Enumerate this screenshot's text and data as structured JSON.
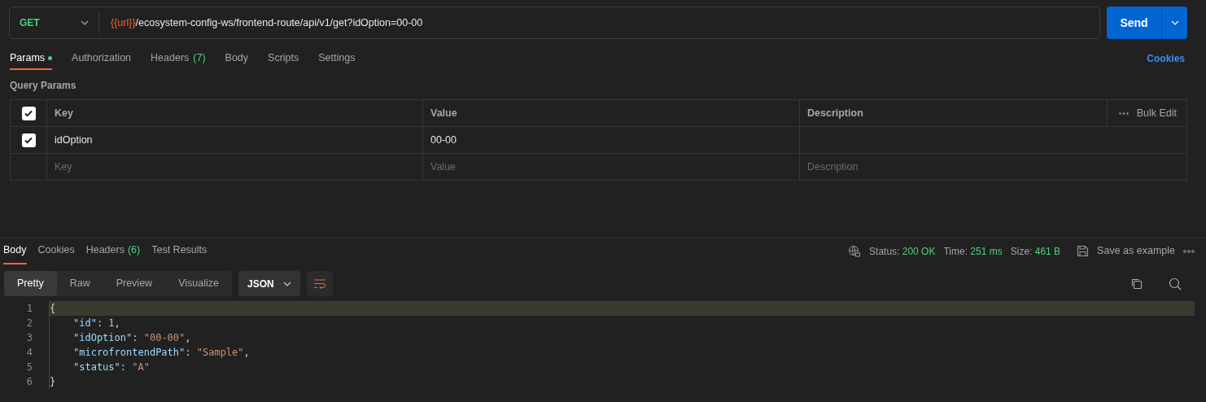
{
  "request": {
    "method": "GET",
    "url_variable": "{{url}}",
    "url_path": "/ecosystem-config-ws/frontend-route/api/v1/get?idOption=00-00",
    "send": "Send"
  },
  "request_tabs": [
    {
      "label": "Params",
      "selected": true,
      "dot": true
    },
    {
      "label": "Authorization",
      "selected": false,
      "dot": false
    },
    {
      "label": "Headers",
      "count": "(7)",
      "selected": false,
      "dot": false
    },
    {
      "label": "Body",
      "selected": false,
      "dot": false
    },
    {
      "label": "Scripts",
      "selected": false,
      "dot": false
    },
    {
      "label": "Settings",
      "selected": false,
      "dot": false
    }
  ],
  "cookies_link": "Cookies",
  "query_params": {
    "title": "Query Params",
    "columns": [
      "Key",
      "Value",
      "Description"
    ],
    "bulk_edit": "Bulk Edit",
    "all_checked": true,
    "rows": [
      {
        "key": "idOption",
        "value": "00-00",
        "checked": true
      }
    ],
    "new_row": {
      "key_placeholder": "Key",
      "value_placeholder": "Value",
      "description_placeholder": "Description"
    }
  },
  "response": {
    "tabs": [
      {
        "label": "Body",
        "selected": true
      },
      {
        "label": "Cookies",
        "selected": false
      },
      {
        "label": "Headers",
        "count": "(6)",
        "selected": false
      },
      {
        "label": "Test Results",
        "selected": false
      }
    ],
    "status_label": "Status:",
    "status": "200 OK",
    "time_label": "Time:",
    "time": "251 ms",
    "size_label": "Size:",
    "size": "461 B",
    "save": "Save as example",
    "view_modes": [
      {
        "label": "Pretty",
        "selected": true
      },
      {
        "label": "Raw",
        "selected": false
      },
      {
        "label": "Preview",
        "selected": false
      },
      {
        "label": "Visualize",
        "selected": false
      }
    ],
    "format": "JSON",
    "code": [
      {
        "number": "1",
        "indent": false,
        "highlighted": true,
        "tokens": [
          {
            "kind": "punct",
            "text": "{"
          }
        ]
      },
      {
        "number": "2",
        "indent": true,
        "highlighted": false,
        "tokens": [
          {
            "kind": "key",
            "text": "\"id\""
          },
          {
            "kind": "punct",
            "text": ": "
          },
          {
            "kind": "number",
            "text": "1"
          },
          {
            "kind": "punct",
            "text": ","
          }
        ]
      },
      {
        "number": "3",
        "indent": true,
        "highlighted": false,
        "tokens": [
          {
            "kind": "key",
            "text": "\"idOption\""
          },
          {
            "kind": "punct",
            "text": ": "
          },
          {
            "kind": "string",
            "text": "\"00-00\""
          },
          {
            "kind": "punct",
            "text": ","
          }
        ]
      },
      {
        "number": "4",
        "indent": true,
        "highlighted": false,
        "tokens": [
          {
            "kind": "key",
            "text": "\"microfrontendPath\""
          },
          {
            "kind": "punct",
            "text": ": "
          },
          {
            "kind": "string",
            "text": "\"Sample\""
          },
          {
            "kind": "punct",
            "text": ","
          }
        ]
      },
      {
        "number": "5",
        "indent": true,
        "highlighted": false,
        "tokens": [
          {
            "kind": "key",
            "text": "\"status\""
          },
          {
            "kind": "punct",
            "text": ": "
          },
          {
            "kind": "string",
            "text": "\"A\""
          }
        ]
      },
      {
        "number": "6",
        "indent": false,
        "highlighted": false,
        "tokens": [
          {
            "kind": "punct",
            "text": "}"
          }
        ]
      }
    ]
  }
}
